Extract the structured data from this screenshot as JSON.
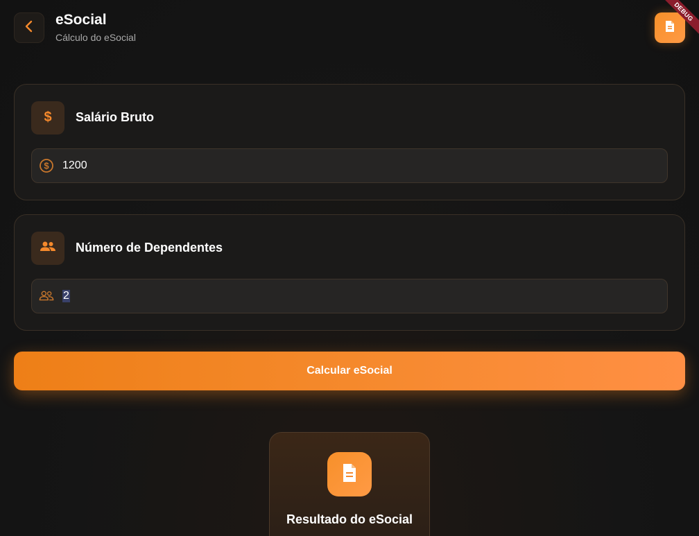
{
  "header": {
    "title": "eSocial",
    "subtitle": "Cálculo do eSocial",
    "back_icon": "chevron-left-icon",
    "action_icon": "document-icon",
    "debug_label": "DEBUG"
  },
  "salario": {
    "title": "Salário Bruto",
    "icon": "dollar-icon",
    "field_icon": "coin-dollar-icon",
    "value": "1200"
  },
  "dependentes": {
    "title": "Número de Dependentes",
    "icon": "people-icon",
    "field_icon": "people-outline-icon",
    "value": "2"
  },
  "calculate": {
    "label": "Calcular eSocial"
  },
  "result": {
    "title": "Resultado do eSocial",
    "icon": "document-icon"
  },
  "colors": {
    "accent": "#f5892c",
    "background": "#151515",
    "card": "#1b1a19",
    "debug_banner": "#8b1d2c"
  }
}
